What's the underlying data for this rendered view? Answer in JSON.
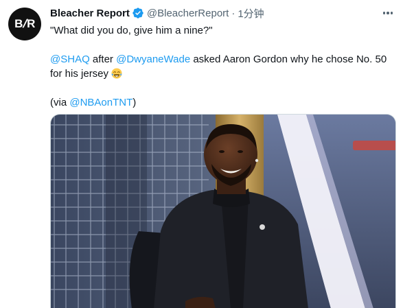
{
  "tweet": {
    "avatar_text_left": "B",
    "avatar_text_right": "R",
    "display_name": "Bleacher Report",
    "handle": "@BleacherReport",
    "separator": "·",
    "timestamp": "1分钟",
    "verified": true,
    "quote_line": "\"What did you do, give him a nine?\"",
    "mention_1": "@SHAQ",
    "text_after_mention_1": " after ",
    "mention_2": "@DwyaneWade",
    "text_after_mention_2": " asked Aaron Gordon why he chose No. 50 for his jersey ",
    "emoji": "face-with-tears-of-joy-icon",
    "via_prefix": "(via ",
    "via_mention": "@NBAonTNT",
    "via_suffix": ")",
    "accent_color": "#1d9bf0"
  },
  "media": {
    "kind": "video-still",
    "subject": "smiling man in dark suit in studio"
  }
}
